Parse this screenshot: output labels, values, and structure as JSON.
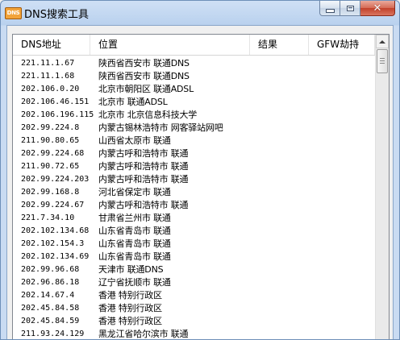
{
  "window": {
    "icon_text": "DNS",
    "title": "DNS搜索工具",
    "controls": {
      "minimize": "minimize-icon",
      "maximize": "maximize-icon",
      "close": "close-icon"
    }
  },
  "list": {
    "columns": [
      "DNS地址",
      "位置",
      "结果",
      "GFW劫持"
    ],
    "rows": [
      {
        "ip": "221.11.1.67",
        "location": "陕西省西安市 联通DNS"
      },
      {
        "ip": "221.11.1.68",
        "location": "陕西省西安市 联通DNS"
      },
      {
        "ip": "202.106.0.20",
        "location": "北京市朝阳区 联通ADSL"
      },
      {
        "ip": "202.106.46.151",
        "location": "北京市 联通ADSL"
      },
      {
        "ip": "202.106.196.115",
        "location": "北京市 北京信息科技大学"
      },
      {
        "ip": "202.99.224.8",
        "location": "内蒙古锡林浩特市 网客驿站网吧"
      },
      {
        "ip": "211.90.80.65",
        "location": "山西省太原市 联通"
      },
      {
        "ip": "202.99.224.68",
        "location": "内蒙古呼和浩特市 联通"
      },
      {
        "ip": "211.90.72.65",
        "location": "内蒙古呼和浩特市 联通"
      },
      {
        "ip": "202.99.224.203",
        "location": "内蒙古呼和浩特市 联通"
      },
      {
        "ip": "202.99.168.8",
        "location": "河北省保定市 联通"
      },
      {
        "ip": "202.99.224.67",
        "location": "内蒙古呼和浩特市 联通"
      },
      {
        "ip": "221.7.34.10",
        "location": "甘肃省兰州市 联通"
      },
      {
        "ip": "202.102.134.68",
        "location": "山东省青岛市 联通"
      },
      {
        "ip": "202.102.154.3",
        "location": "山东省青岛市 联通"
      },
      {
        "ip": "202.102.134.69",
        "location": "山东省青岛市 联通"
      },
      {
        "ip": "202.99.96.68",
        "location": "天津市 联通DNS"
      },
      {
        "ip": "202.96.86.18",
        "location": "辽宁省抚顺市 联通"
      },
      {
        "ip": "202.14.67.4",
        "location": "香港 特别行政区"
      },
      {
        "ip": "202.45.84.58",
        "location": "香港 特别行政区"
      },
      {
        "ip": "202.45.84.59",
        "location": "香港 特别行政区"
      },
      {
        "ip": "211.93.24.129",
        "location": "黑龙江省哈尔滨市 联通"
      }
    ]
  },
  "scrollbar": {
    "up_arrow": "arrow-up-icon"
  },
  "colors": {
    "title_gradient_top": "#cfe0f5",
    "close_red": "#c2412a",
    "app_icon": "#f2a33a"
  }
}
